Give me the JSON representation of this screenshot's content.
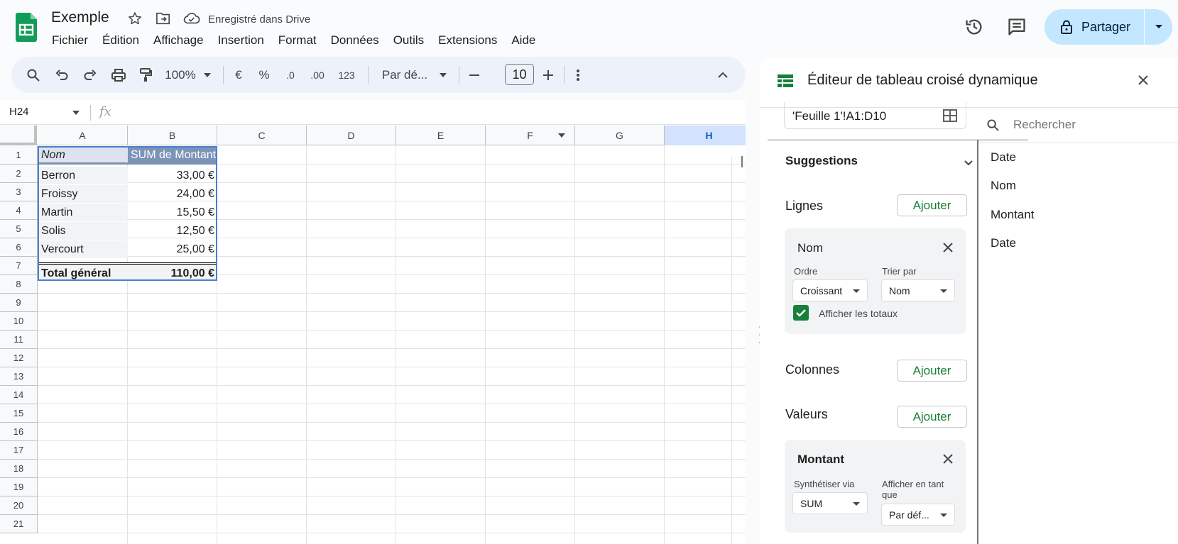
{
  "header": {
    "doc_title": "Exemple",
    "save_status": "Enregistré dans Drive",
    "share_label": "Partager"
  },
  "menu": [
    "Fichier",
    "Édition",
    "Affichage",
    "Insertion",
    "Format",
    "Données",
    "Outils",
    "Extensions",
    "Aide"
  ],
  "toolbar": {
    "zoom": "100%",
    "currency": "€",
    "percent": "%",
    "dec_less": ".0",
    "dec_more": ".00",
    "number_format": "123",
    "font": "Par dé...",
    "font_size": "10"
  },
  "formula_bar": {
    "cell_ref": "H24",
    "fx": "fx"
  },
  "grid": {
    "columns": [
      "A",
      "B",
      "C",
      "D",
      "E",
      "F",
      "G",
      "H"
    ],
    "rows": [
      "1",
      "2",
      "3",
      "4",
      "5",
      "6",
      "7",
      "8",
      "9",
      "10",
      "11",
      "12",
      "13",
      "14",
      "15",
      "16",
      "17",
      "18",
      "19",
      "20",
      "21"
    ],
    "pivot_header": [
      "Nom",
      "SUM de Montant"
    ],
    "pivot_rows": [
      [
        "Berron",
        "33,00 €"
      ],
      [
        "Froissy",
        "24,00 €"
      ],
      [
        "Martin",
        "15,50 €"
      ],
      [
        "Solis",
        "12,50 €"
      ],
      [
        "Vercourt",
        "25,00 €"
      ]
    ],
    "total": [
      "Total général",
      "110,00 €"
    ]
  },
  "panel": {
    "title": "Éditeur de tableau croisé dynamique",
    "range": "'Feuille 1'!A1:D10",
    "suggestions": "Suggestions",
    "rows_label": "Lignes",
    "columns_label": "Colonnes",
    "values_label": "Valeurs",
    "add_label": "Ajouter",
    "row_card": {
      "title": "Nom",
      "order_label": "Ordre",
      "order_value": "Croissant",
      "sort_label": "Trier par",
      "sort_value": "Nom",
      "totals_label": "Afficher les totaux"
    },
    "value_card": {
      "title": "Montant",
      "summarize_label": "Synthétiser via",
      "summarize_value": "SUM",
      "show_as_label_1": "Afficher en tant",
      "show_as_label_2": "que",
      "show_as_value": "Par déf..."
    },
    "search_placeholder": "Rechercher",
    "fields": [
      "Date",
      "Nom",
      "Montant",
      "Date"
    ]
  }
}
